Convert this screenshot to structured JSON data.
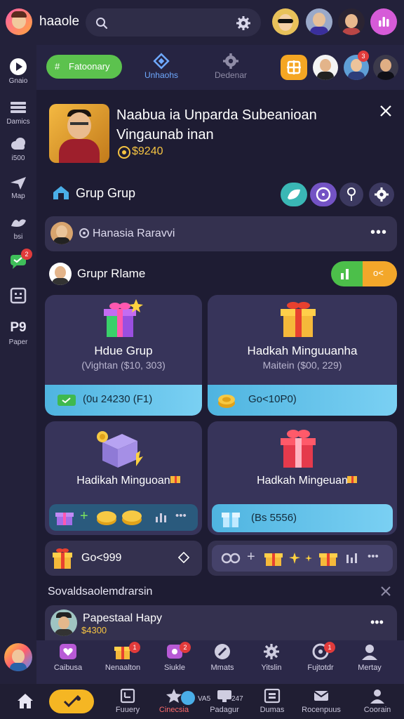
{
  "header": {
    "app_name": "haaole",
    "search_placeholder": "",
    "icons": [
      "search-icon",
      "gear-icon",
      "chart-icon"
    ]
  },
  "sidebar": {
    "items": [
      {
        "label": "Gnaio",
        "icon": "play-icon"
      },
      {
        "label": "Damics",
        "icon": "list-icon"
      },
      {
        "label": "i500",
        "icon": "cloud-icon"
      },
      {
        "label": "Map",
        "icon": "plane-icon"
      },
      {
        "label": "bsi",
        "icon": "bird-icon"
      },
      {
        "label": "",
        "icon": "chat-icon",
        "badge": "2"
      },
      {
        "label": "",
        "icon": "grid-icon"
      },
      {
        "label": "Paper",
        "icon": "p9-icon",
        "glyph": "P9"
      }
    ]
  },
  "tabs": [
    {
      "label": "Fatoonary",
      "active": true
    },
    {
      "label": "Unhaohs",
      "active": false
    },
    {
      "label": "Dedenar",
      "active": false
    }
  ],
  "tab_badges": {
    "right_avatar_badge": "3"
  },
  "banner": {
    "title": "Naabua ia Unparda Subeanioan Vingaunab inan",
    "price": "$9240"
  },
  "group": {
    "title": "Grup Grup",
    "member_name": "Hanasia Raravvi",
    "rlame_title": "Grupr Rlame",
    "toggle_label": "o<"
  },
  "cards": [
    {
      "title": "Hdue Grup",
      "sub": "(Vightan ($10, 303)",
      "bar": "(0u 24230 (F1)"
    },
    {
      "title": "Hadkah Minguuanha",
      "sub": "Maitein ($00, 229)",
      "bar": "Go<10P0)"
    },
    {
      "title": "Hadikah Minguoan",
      "sub": "",
      "bar": ""
    },
    {
      "title": "Hadkah Mingeuan",
      "sub": "",
      "bar": "(Bs 5556)"
    }
  ],
  "go_bar": {
    "label": "Go<999"
  },
  "section": {
    "title": "Sovaldsaolemdrarsin"
  },
  "list_item": {
    "title": "Papestaal Hapy",
    "sub": "$4300"
  },
  "bottom_nav_1": [
    {
      "label": "Caibusa"
    },
    {
      "label": "Nenaalton",
      "badge": "1"
    },
    {
      "label": "Siukle",
      "badge": "2"
    },
    {
      "label": "Mmats"
    },
    {
      "label": "Yitslin"
    },
    {
      "label": "Fujtotdr",
      "badge": "1"
    },
    {
      "label": "Mertay"
    }
  ],
  "bottom_nav_2": [
    {
      "label": ""
    },
    {
      "label": ""
    },
    {
      "label": "Fuuery"
    },
    {
      "label": "Cinecsia"
    },
    {
      "label": "Padagur"
    },
    {
      "label": "Dumas"
    },
    {
      "label": "Rocenpuus"
    },
    {
      "label": "Coorain"
    }
  ],
  "bottom_nav_2_extra": {
    "count1": "VA5",
    "count2": "247"
  },
  "colors": {
    "accent_green": "#5cc24e",
    "accent_blue": "#6fa9ff",
    "gold": "#f5c342",
    "badge_red": "#e13b3b"
  }
}
